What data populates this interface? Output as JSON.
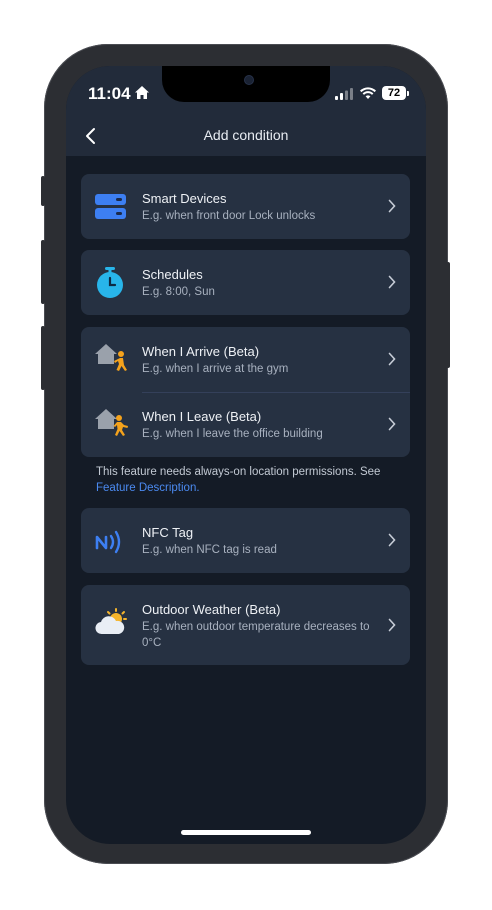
{
  "status_bar": {
    "time": "11:04",
    "battery": "72"
  },
  "header": {
    "title": "Add condition"
  },
  "items": [
    {
      "title": "Smart Devices",
      "subtitle": "E.g. when front door Lock unlocks",
      "icon": "smart-devices-icon"
    },
    {
      "title": "Schedules",
      "subtitle": "E.g. 8:00, Sun",
      "icon": "clock-icon"
    },
    {
      "title": "When I Arrive (Beta)",
      "subtitle": "E.g. when I arrive at the gym",
      "icon": "arrive-home-icon"
    },
    {
      "title": "When I Leave (Beta)",
      "subtitle": "E.g. when I leave the office building",
      "icon": "leave-home-icon"
    },
    {
      "title": "NFC Tag",
      "subtitle": "E.g. when NFC tag is read",
      "icon": "nfc-icon"
    },
    {
      "title": "Outdoor Weather (Beta)",
      "subtitle": "E.g. when outdoor temperature decreases to 0°C",
      "icon": "weather-icon"
    }
  ],
  "location_note": {
    "text": "This feature needs always-on location permissions. See",
    "link": "Feature Description."
  },
  "colors": {
    "background": "#141b26",
    "card": "#263142",
    "accent_blue": "#3d7ff2",
    "accent_cyan": "#28b5ea",
    "accent_orange": "#f4a21c",
    "link": "#4b8af0"
  }
}
